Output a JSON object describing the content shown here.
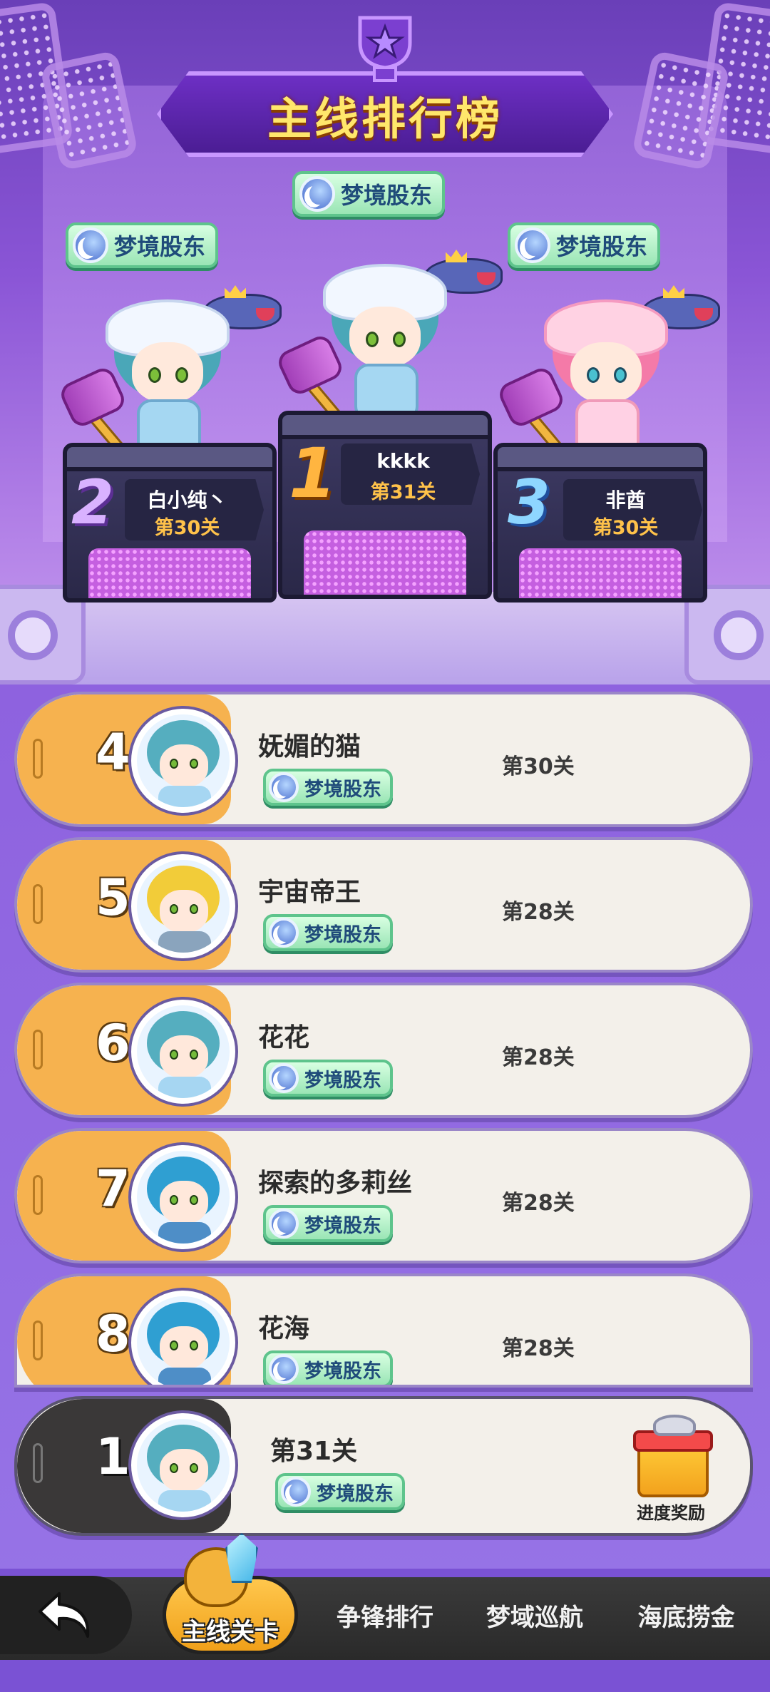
{
  "title": "主线排行榜",
  "badge_label": "梦境股东",
  "podium": [
    {
      "rank": "1",
      "name": "kkkk",
      "level": "第31关"
    },
    {
      "rank": "2",
      "name": "白小纯丶",
      "level": "第30关"
    },
    {
      "rank": "3",
      "name": "非酋",
      "level": "第30关"
    }
  ],
  "list": [
    {
      "rank": "4",
      "name": "妩媚的猫",
      "level": "第30关",
      "avatar": "teal-hood"
    },
    {
      "rank": "5",
      "name": "宇宙帝王",
      "level": "第28关",
      "avatar": "blond"
    },
    {
      "rank": "6",
      "name": "花花",
      "level": "第28关",
      "avatar": "teal-hood"
    },
    {
      "rank": "7",
      "name": "探索的多莉丝",
      "level": "第28关",
      "avatar": "sea"
    },
    {
      "rank": "8",
      "name": "花海",
      "level": "第28关",
      "avatar": "sea"
    }
  ],
  "self": {
    "rank": "1",
    "level": "第31关",
    "reward_label": "进度奖励"
  },
  "nav": {
    "back_icon": "back-arrow-icon",
    "tabs": [
      {
        "label": "主线关卡",
        "active": true
      },
      {
        "label": "争锋排行",
        "active": false
      },
      {
        "label": "梦域巡航",
        "active": false
      },
      {
        "label": "海底捞金",
        "active": false
      }
    ]
  },
  "colors": {
    "accent": "#f6b24f",
    "title": "#ffe76b",
    "level": "#ffc24a",
    "badge": "#9ae5b5"
  }
}
